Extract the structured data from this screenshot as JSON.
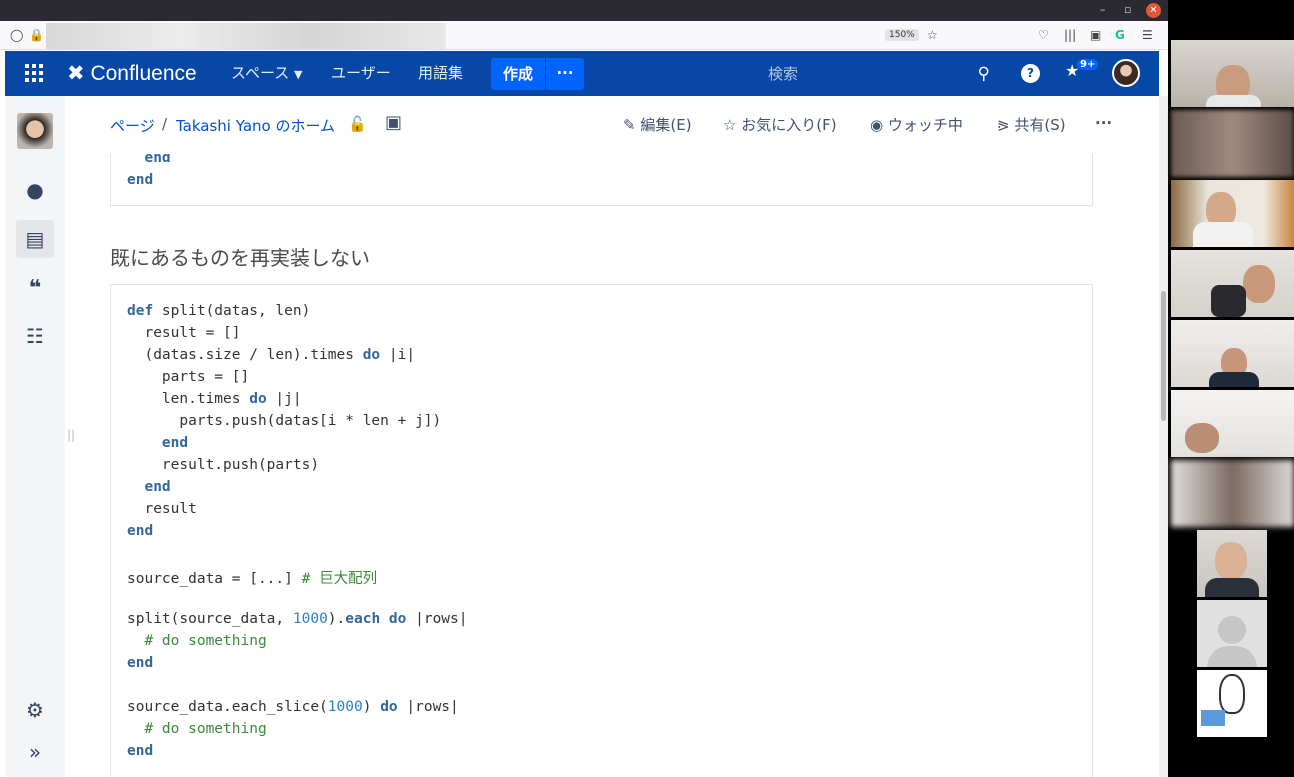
{
  "browser": {
    "zoom": "150%",
    "window_controls": {
      "minimize": "–",
      "maximize": "▫",
      "close": "✕"
    }
  },
  "nav": {
    "logo": "Confluence",
    "spaces": "スペース",
    "users": "ユーザー",
    "glossary": "用語集",
    "create": "作成",
    "more": "···",
    "search_placeholder": "検索",
    "notif_badge": "9+"
  },
  "breadcrumb": {
    "pages": "ページ",
    "separator": "/",
    "home": "Takashi Yano のホーム"
  },
  "actions": {
    "edit": "編集(E)",
    "favorite": "お気に入り(F)",
    "watch": "ウォッチ中",
    "share": "共有(S)",
    "more": "···"
  },
  "content": {
    "top_code": [
      [
        {
          "t": "  "
        },
        {
          "t": "end",
          "c": "kw"
        }
      ],
      [
        {
          "t": "end",
          "c": "kw"
        }
      ]
    ],
    "heading": "既にあるものを再実装しない",
    "code": [
      [
        {
          "t": "def",
          "c": "kw"
        },
        {
          "t": " split(datas, len)"
        }
      ],
      [
        {
          "t": "  result = []"
        }
      ],
      [
        {
          "t": "  (datas.size / len).times "
        },
        {
          "t": "do",
          "c": "kw"
        },
        {
          "t": " |i|"
        }
      ],
      [
        {
          "t": "    parts = []"
        }
      ],
      [
        {
          "t": "    len.times "
        },
        {
          "t": "do",
          "c": "kw"
        },
        {
          "t": " |j|"
        }
      ],
      [
        {
          "t": "      parts.push(datas[i * len + j])"
        }
      ],
      [
        {
          "t": "    "
        },
        {
          "t": "end",
          "c": "kw"
        }
      ],
      [
        {
          "t": "    result.push(parts)"
        }
      ],
      [
        {
          "t": "  "
        },
        {
          "t": "end",
          "c": "kw"
        }
      ],
      [
        {
          "t": "  result"
        }
      ],
      [
        {
          "t": "end",
          "c": "kw"
        }
      ],
      [
        {
          "t": ""
        }
      ],
      [
        {
          "t": "source_data = [...] "
        },
        {
          "t": "# 巨大配列",
          "c": "cm"
        }
      ],
      [
        {
          "t": ""
        }
      ],
      [
        {
          "t": "split(source_data, "
        },
        {
          "t": "1000",
          "c": "num"
        },
        {
          "t": ")."
        },
        {
          "t": "each",
          "c": "kw"
        },
        {
          "t": " "
        },
        {
          "t": "do",
          "c": "kw"
        },
        {
          "t": " |rows|"
        }
      ],
      [
        {
          "t": "  "
        },
        {
          "t": "# do something",
          "c": "cm"
        }
      ],
      [
        {
          "t": "end",
          "c": "kw"
        }
      ],
      [
        {
          "t": ""
        }
      ],
      [
        {
          "t": "source_data.each_slice("
        },
        {
          "t": "1000",
          "c": "num"
        },
        {
          "t": ") "
        },
        {
          "t": "do",
          "c": "kw"
        },
        {
          "t": " |rows|"
        }
      ],
      [
        {
          "t": "  "
        },
        {
          "t": "# do something",
          "c": "cm"
        }
      ],
      [
        {
          "t": "end",
          "c": "kw"
        }
      ]
    ]
  },
  "colors": {
    "nav_bg": "#0747a6",
    "create_btn": "#0065ff",
    "keyword": "#336699",
    "number": "#2b7fc5",
    "comment": "#3a8a3a"
  }
}
